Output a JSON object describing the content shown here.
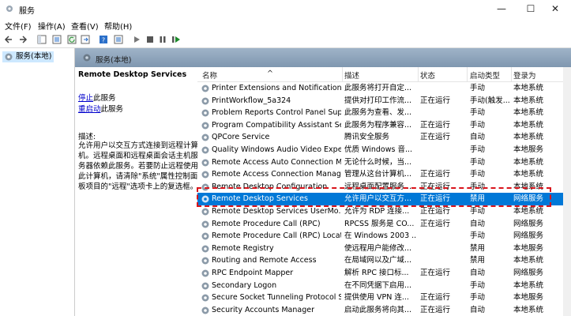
{
  "window": {
    "title": "服务",
    "min_glyph": "—",
    "max_glyph": "☐",
    "close_glyph": "✕"
  },
  "menu": [
    {
      "label": "文件(F)"
    },
    {
      "label": "操作(A)"
    },
    {
      "label": "查看(V)"
    },
    {
      "label": "帮助(H)"
    }
  ],
  "tree": {
    "root_label": "服务(本地)"
  },
  "header": {
    "title": "服务(本地)"
  },
  "detail": {
    "service_name": "Remote Desktop Services",
    "stop_link": "停止",
    "stop_suffix": "此服务",
    "restart_link": "重启动",
    "restart_suffix": "此服务",
    "desc_label": "描述:",
    "desc_text": "允许用户以交互方式连接到远程计算机。远程桌面和远程桌面会话主机服务器依赖此服务。若要防止远程使用此计算机，请清除\"系统\"属性控制面板项目的\"远程\"选项卡上的复选框。"
  },
  "columns": {
    "name": "名称",
    "desc": "描述",
    "status": "状态",
    "start": "启动类型",
    "logon": "登录为",
    "sort_glyph": "^"
  },
  "rows": [
    {
      "name": "Printer Extensions and Notifications",
      "desc": "此服务将打开自定...",
      "status": "",
      "start": "手动",
      "logon": "本地系统"
    },
    {
      "name": "PrintWorkflow_5a324",
      "desc": "提供对打印工作流...",
      "status": "正在运行",
      "start": "手动(触发...",
      "logon": "本地系统"
    },
    {
      "name": "Problem Reports Control Panel Sup...",
      "desc": "此服务为查看、发...",
      "status": "",
      "start": "手动",
      "logon": "本地系统"
    },
    {
      "name": "Program Compatibility Assistant Se...",
      "desc": "此服务为程序兼容...",
      "status": "正在运行",
      "start": "手动",
      "logon": "本地系统"
    },
    {
      "name": "QPCore Service",
      "desc": "腾讯安全服务",
      "status": "正在运行",
      "start": "自动",
      "logon": "本地系统"
    },
    {
      "name": "Quality Windows Audio Video Expe...",
      "desc": "优质 Windows 音...",
      "status": "",
      "start": "手动",
      "logon": "本地服务"
    },
    {
      "name": "Remote Access Auto Connection M...",
      "desc": "无论什么时候，当...",
      "status": "",
      "start": "手动",
      "logon": "本地系统"
    },
    {
      "name": "Remote Access Connection Manager",
      "desc": "管理从这台计算机...",
      "status": "正在运行",
      "start": "手动",
      "logon": "本地系统"
    },
    {
      "name": "Remote Desktop Configuration",
      "desc": "远程桌面配置服务...",
      "status": "正在运行",
      "start": "手动",
      "logon": "本地系统"
    },
    {
      "name": "Remote Desktop Services",
      "desc": "允许用户以交互方...",
      "status": "正在运行",
      "start": "禁用",
      "logon": "网络服务",
      "selected": true
    },
    {
      "name": "Remote Desktop Services UserMo...",
      "desc": "允许为 RDP 连接...",
      "status": "正在运行",
      "start": "手动",
      "logon": "本地系统"
    },
    {
      "name": "Remote Procedure Call (RPC)",
      "desc": "RPCSS 服务是 CO...",
      "status": "正在运行",
      "start": "自动",
      "logon": "网络服务"
    },
    {
      "name": "Remote Procedure Call (RPC) Locator",
      "desc": "在 Windows 2003 ...",
      "status": "",
      "start": "手动",
      "logon": "网络服务"
    },
    {
      "name": "Remote Registry",
      "desc": "使远程用户能修改...",
      "status": "",
      "start": "禁用",
      "logon": "本地服务"
    },
    {
      "name": "Routing and Remote Access",
      "desc": "在局域网以及广域...",
      "status": "",
      "start": "禁用",
      "logon": "本地系统"
    },
    {
      "name": "RPC Endpoint Mapper",
      "desc": "解析 RPC 接口标...",
      "status": "正在运行",
      "start": "自动",
      "logon": "网络服务"
    },
    {
      "name": "Secondary Logon",
      "desc": "在不同凭据下启用...",
      "status": "",
      "start": "手动",
      "logon": "本地系统"
    },
    {
      "name": "Secure Socket Tunneling Protocol S...",
      "desc": "提供使用 VPN 连...",
      "status": "正在运行",
      "start": "手动",
      "logon": "本地服务"
    },
    {
      "name": "Security Accounts Manager",
      "desc": "启动此服务将向其...",
      "status": "正在运行",
      "start": "自动",
      "logon": "本地系统"
    }
  ]
}
